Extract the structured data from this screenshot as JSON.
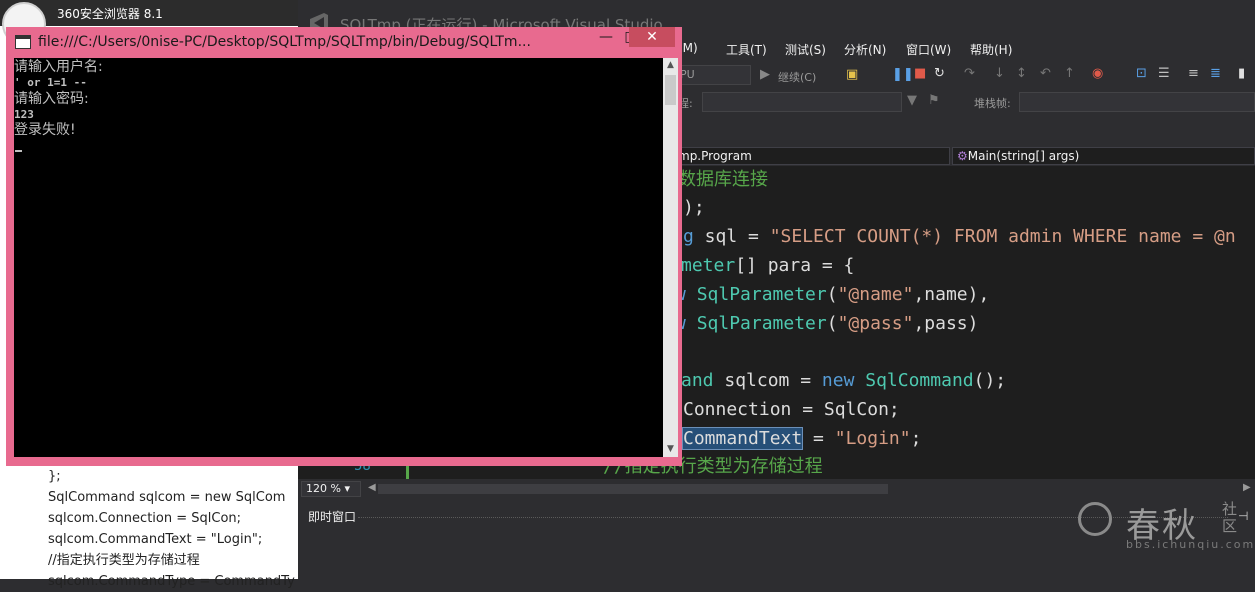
{
  "browser": {
    "title": "360安全浏览器 8.1",
    "code_lines": [
      "};",
      "SqlCommand sqlcom = new SqlCom",
      "sqlcom.Connection = SqlCon;",
      "sqlcom.CommandText = \"Login\";",
      "//指定执行类型为存储过程",
      "sqlcom.CommandType = CommandTy"
    ]
  },
  "vs": {
    "title": "SQLTmp (正在运行) - Microsoft Visual Studio",
    "menu": [
      "(M)",
      "工具(T)",
      "测试(S)",
      "分析(N)",
      "窗口(W)",
      "帮助(H)"
    ],
    "toolbar": {
      "cpu_label": "PU",
      "continue_label": "继续(C)",
      "process_label": "程:",
      "stack_label": "堆栈帧:"
    },
    "nav": {
      "class_dropdown": "mp.Program",
      "method_dropdown": "Main(string[] args)"
    },
    "code": {
      "line1": "数据库连接",
      "line2": ");",
      "line3_kw": "g",
      "line3_var": " sql = ",
      "line3_str": "\"SELECT COUNT(*) FROM admin WHERE name = @n",
      "line4_ty": "meter",
      "line4_rest": "[] para = {",
      "line5_ty": "SqlParameter",
      "line5_str": "\"@name\"",
      "line5_rest": ",name),",
      "line6_ty": "SqlParameter",
      "line6_str": "\"@pass\"",
      "line6_rest": ",pass)",
      "line7_ty": "and",
      "line7_a": " sqlcom = ",
      "line7_kw": "new",
      "line7_ty2": "SqlCommand",
      "line7_rest": "();",
      "line8": "Connection = SqlCon;",
      "line9_hl": "CommandText",
      "line9_eq": " = ",
      "line9_str": "\"Login\"",
      "line9_end": ";",
      "line10": "//指定执行类型为存储过程",
      "line_number": "58"
    },
    "zoom": "120 %",
    "immediate_label": "即时窗口"
  },
  "console": {
    "title": "file:///C:/Users/0nise-PC/Desktop/SQLTmp/SQLTmp/bin/Debug/SQLTm...",
    "lines": [
      "请输入用户名:",
      "' or 1=1 --",
      "请输入密码:",
      "123",
      "登录失败!"
    ]
  },
  "watermark": {
    "brand": "春秋",
    "sub": "社区",
    "url": "bbs.ichunqiu.com"
  }
}
